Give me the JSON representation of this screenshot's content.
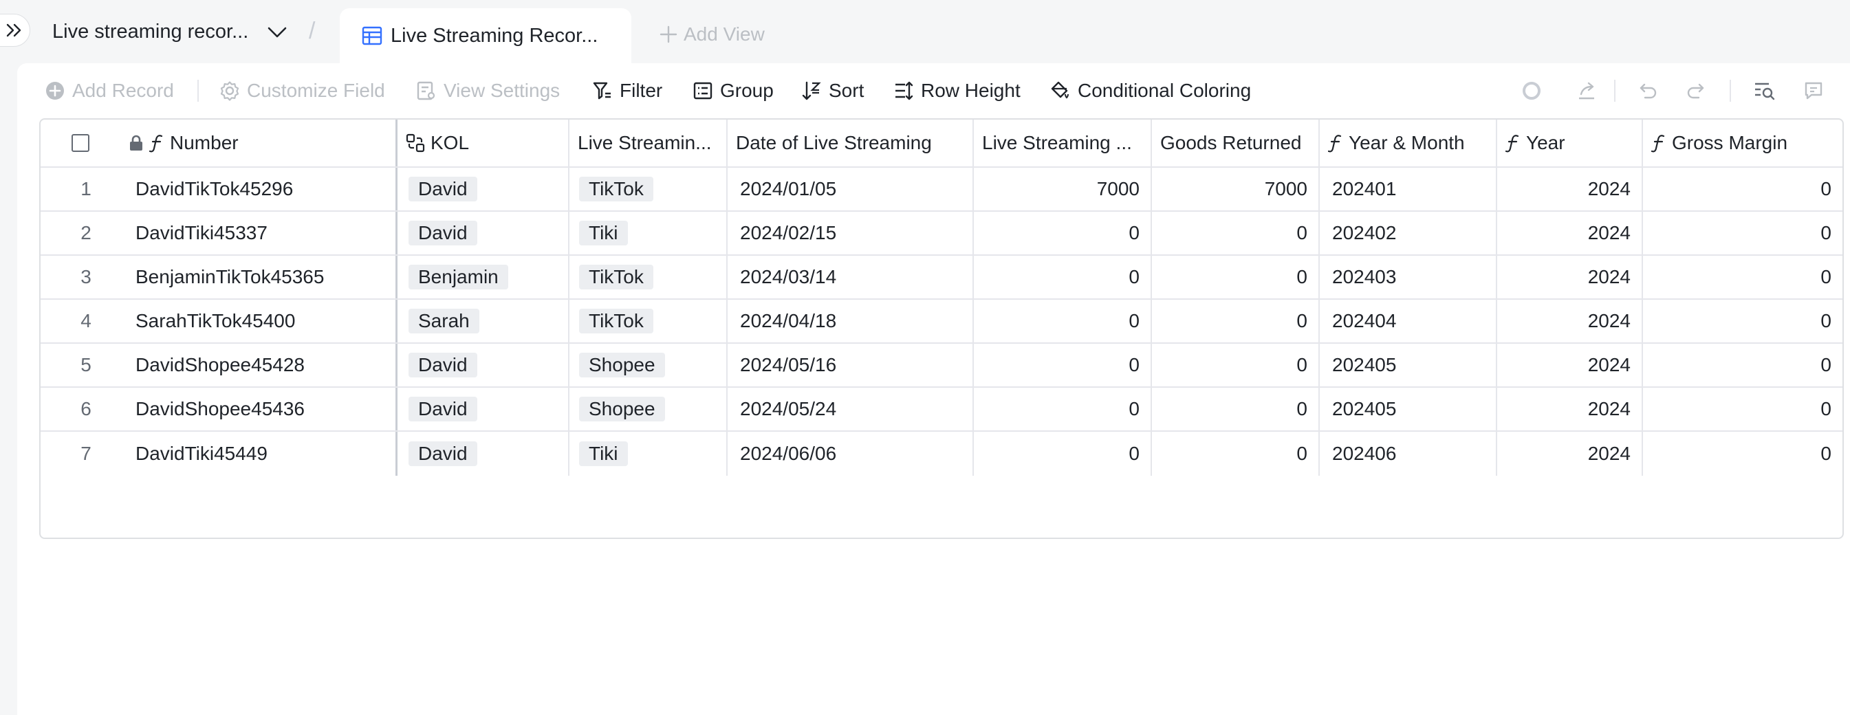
{
  "header": {
    "table_name": "Live streaming recor...",
    "separator": "/",
    "active_view": "Live Streaming Recor...",
    "add_view": "Add View"
  },
  "toolbar": {
    "add_record": "Add Record",
    "customize_field": "Customize Field",
    "view_settings": "View Settings",
    "filter": "Filter",
    "group": "Group",
    "sort": "Sort",
    "row_height": "Row Height",
    "conditional_coloring": "Conditional Coloring"
  },
  "columns": [
    {
      "label": "Number",
      "icon": "formula-icon"
    },
    {
      "label": "KOL",
      "icon": "link-icon"
    },
    {
      "label": "Live Streamin...",
      "icon": ""
    },
    {
      "label": "Date of Live Streaming",
      "icon": ""
    },
    {
      "label": "Live Streaming ...",
      "icon": ""
    },
    {
      "label": "Goods Returned",
      "icon": ""
    },
    {
      "label": "Year & Month",
      "icon": "formula-icon"
    },
    {
      "label": "Year",
      "icon": "formula-icon"
    },
    {
      "label": "Gross Margin",
      "icon": "formula-icon"
    }
  ],
  "rows": [
    {
      "n": "1",
      "number": "DavidTikTok45296",
      "kol": "David",
      "platform": "TikTok",
      "date": "2024/01/05",
      "sales": "7000",
      "returned": "7000",
      "ym": "202401",
      "year": "2024",
      "gm": "0"
    },
    {
      "n": "2",
      "number": "DavidTiki45337",
      "kol": "David",
      "platform": "Tiki",
      "date": "2024/02/15",
      "sales": "0",
      "returned": "0",
      "ym": "202402",
      "year": "2024",
      "gm": "0"
    },
    {
      "n": "3",
      "number": "BenjaminTikTok45365",
      "kol": "Benjamin",
      "platform": "TikTok",
      "date": "2024/03/14",
      "sales": "0",
      "returned": "0",
      "ym": "202403",
      "year": "2024",
      "gm": "0"
    },
    {
      "n": "4",
      "number": "SarahTikTok45400",
      "kol": "Sarah",
      "platform": "TikTok",
      "date": "2024/04/18",
      "sales": "0",
      "returned": "0",
      "ym": "202404",
      "year": "2024",
      "gm": "0"
    },
    {
      "n": "5",
      "number": "DavidShopee45428",
      "kol": "David",
      "platform": "Shopee",
      "date": "2024/05/16",
      "sales": "0",
      "returned": "0",
      "ym": "202405",
      "year": "2024",
      "gm": "0"
    },
    {
      "n": "6",
      "number": "DavidShopee45436",
      "kol": "David",
      "platform": "Shopee",
      "date": "2024/05/24",
      "sales": "0",
      "returned": "0",
      "ym": "202405",
      "year": "2024",
      "gm": "0"
    },
    {
      "n": "7",
      "number": "DavidTiki45449",
      "kol": "David",
      "platform": "Tiki",
      "date": "2024/06/06",
      "sales": "0",
      "returned": "0",
      "ym": "202406",
      "year": "2024",
      "gm": "0"
    }
  ]
}
